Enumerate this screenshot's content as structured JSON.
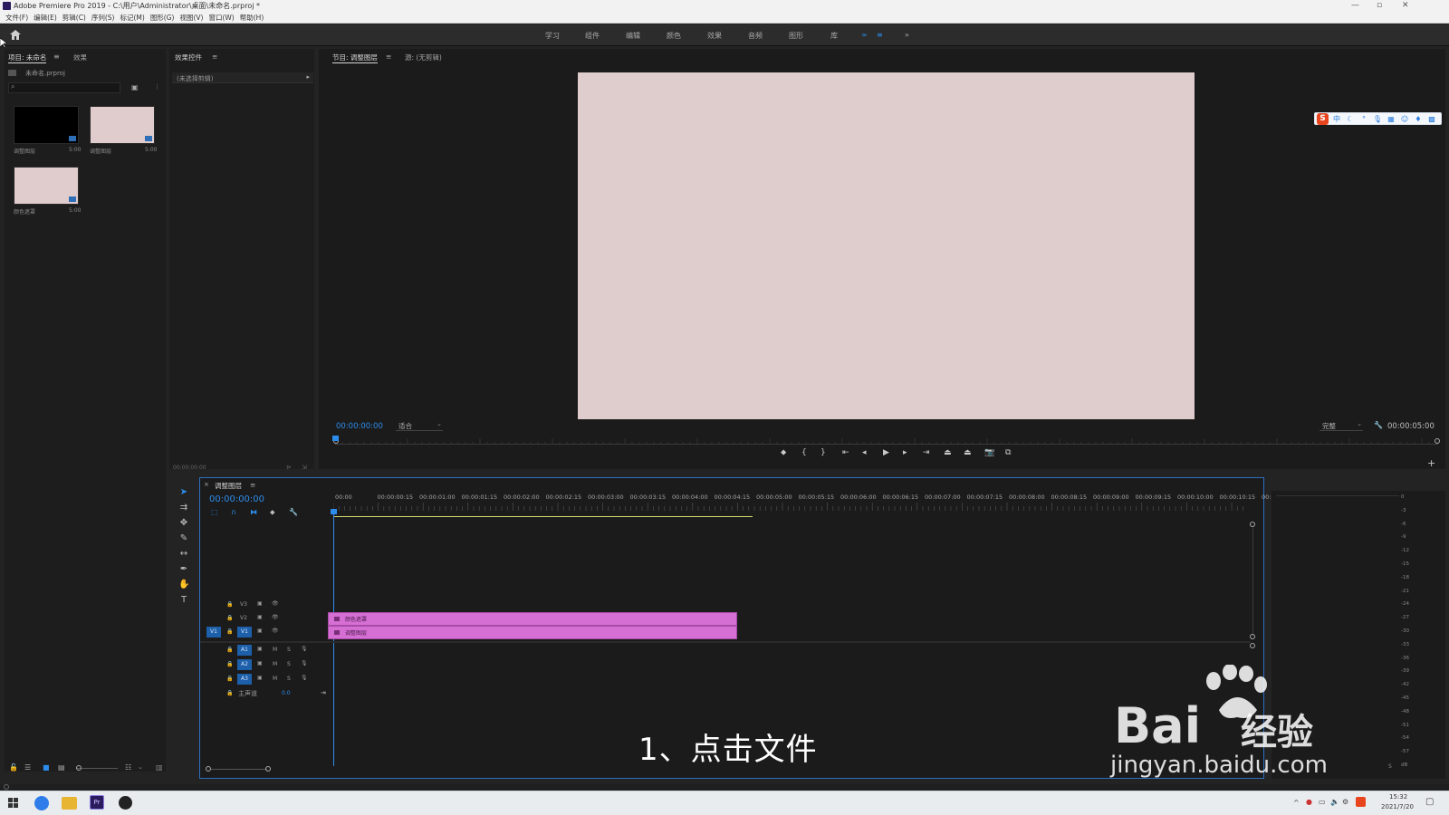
{
  "window": {
    "title": "Adobe Premiere Pro 2019 - C:\\用户\\Administrator\\桌面\\未命名.prproj *"
  },
  "menu": [
    "文件(F)",
    "编辑(E)",
    "剪辑(C)",
    "序列(S)",
    "标记(M)",
    "图形(G)",
    "视图(V)",
    "窗口(W)",
    "帮助(H)"
  ],
  "workspaces": [
    "学习",
    "组件",
    "编辑",
    "颜色",
    "效果",
    "音频",
    "图形",
    "库",
    "∞",
    "≡",
    "»"
  ],
  "project_panel": {
    "tab_project": "项目: 未命名",
    "tab_effects": "效果",
    "file_name": "未命名.prproj",
    "search_placeholder": "",
    "items": [
      {
        "name": "调整图层",
        "duration": "5:00",
        "color": "#000000"
      },
      {
        "name": "调整图层",
        "duration": "5:00",
        "color": "#e0cbcd"
      },
      {
        "name": "颜色遮罩",
        "duration": "5:00",
        "color": "#e0cbcd"
      }
    ]
  },
  "effect_controls": {
    "title": "效果控件",
    "clip_dropdown": "(未选择剪辑)",
    "timecode": "00:00:00:00"
  },
  "program_monitor": {
    "tab_program": "节目: 调整图层",
    "tab_source": "源: (无剪辑)",
    "timecode": "00:00:00:00",
    "zoom": "适合",
    "quality": "完整",
    "duration": "00:00:05:00",
    "frame_color": "#dfcccd"
  },
  "timeline": {
    "title": "调整图层",
    "timecode": "00:00:00:00",
    "ruler": [
      "00:00",
      "00:00:00:15",
      "00:00:01:00",
      "00:00:01:15",
      "00:00:02:00",
      "00:00:02:15",
      "00:00:03:00",
      "00:00:03:15",
      "00:00:04:00",
      "00:00:04:15",
      "00:00:05:00",
      "00:00:05:15",
      "00:00:06:00",
      "00:00:06:15",
      "00:00:07:00",
      "00:00:07:15",
      "00:00:08:00",
      "00:00:08:15",
      "00:00:09:00",
      "00:00:09:15",
      "00:00:10:00",
      "00:00:10:15",
      "00:"
    ],
    "video_tracks": [
      "V3",
      "V2",
      "V1"
    ],
    "audio_tracks": [
      "A1",
      "A2",
      "A3"
    ],
    "source_patch": "V1",
    "master": "主声道",
    "master_value": "0.0",
    "mute": "M",
    "solo": "S",
    "clips": [
      {
        "name": "颜色遮罩",
        "track": "V2"
      },
      {
        "name": "调整图层",
        "track": "V1"
      }
    ],
    "clip_color": "#d56fd4"
  },
  "audio_meter": {
    "labels": [
      "0",
      "-3",
      "-6",
      "-9",
      "-12",
      "-15",
      "-18",
      "-21",
      "-24",
      "-27",
      "-30",
      "-33",
      "-36",
      "-39",
      "-42",
      "-45",
      "-48",
      "-51",
      "-54",
      "-57",
      "dB"
    ],
    "bottom": "S"
  },
  "caption": "1、点击文件",
  "watermark": {
    "brand": "Bai",
    "brand_cn": "经验",
    "url": "jingyan.baidu.com"
  },
  "ime": {
    "logo": "S",
    "mode": "中"
  },
  "taskbar": {
    "time": "15:32",
    "date": "2021/7/20"
  },
  "accent": "#2d8ceb"
}
